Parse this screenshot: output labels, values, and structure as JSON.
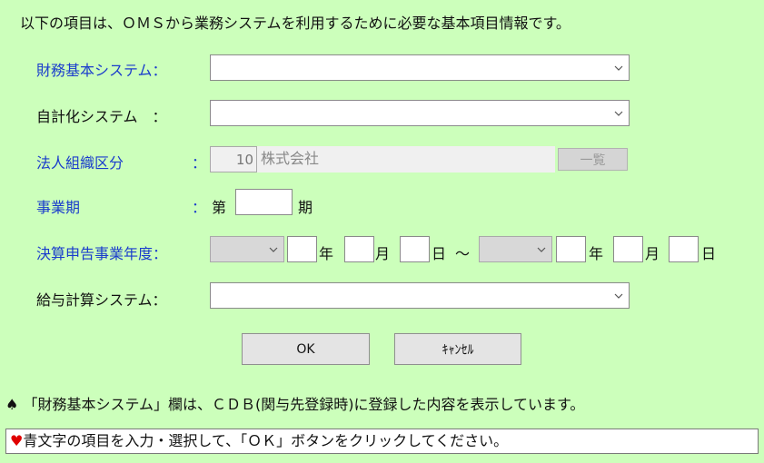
{
  "header": {
    "intro": "以下の項目は、ＯＭＳから業務システムを利用するために必要な基本項目情報です。"
  },
  "form": {
    "zaimu": {
      "label": "財務基本システム：",
      "value": ""
    },
    "jikei": {
      "label": "自計化システム　：",
      "value": ""
    },
    "houjin": {
      "label": "法人組織区分",
      "colon": "：",
      "code": "10",
      "name": "株式会社",
      "list_button": "一覧"
    },
    "jigyouki": {
      "label": "事業期",
      "colon": "：",
      "prefix": "第",
      "value": "",
      "suffix": "期"
    },
    "kessan": {
      "label": "決算申告事業年度：",
      "year_unit": "年",
      "month_unit": "月",
      "day_unit": "日",
      "tilde": "～"
    },
    "kyuyo": {
      "label": "給与計算システム：",
      "value": ""
    }
  },
  "buttons": {
    "ok": "OK",
    "cancel": "ｷｬﾝｾﾙ"
  },
  "note": {
    "spade": "♠",
    "text": "「財務基本システム」欄は、ＣＤＢ(関与先登録時)に登録した内容を表示しています。"
  },
  "status": {
    "heart": "♥",
    "text": "青文字の項目を入力・選択して、「ＯＫ」ボタンをクリックしてください。"
  },
  "colors": {
    "background": "#ccffbb",
    "label_blue": "#1a3ccc",
    "heart_red": "#e00000"
  }
}
